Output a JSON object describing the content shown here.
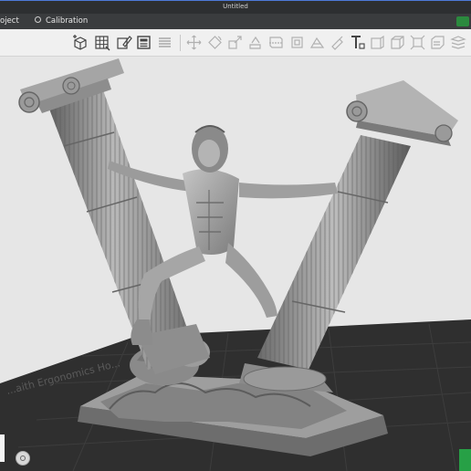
{
  "window": {
    "title": "Untitled"
  },
  "tabs": [
    {
      "label": "oject"
    },
    {
      "label": "Calibration"
    }
  ],
  "toolbar": {
    "buttons": [
      "add-cube-icon",
      "grid-layout-icon",
      "edit-model-icon",
      "slice-panel-icon",
      "list-icon",
      "move-icon",
      "rotate-icon",
      "scale-icon",
      "place-face-icon",
      "cut-icon",
      "support-icon",
      "seam-icon",
      "paint-icon",
      "text-icon",
      "measure-icon",
      "assemble-icon",
      "split-icon",
      "arrange-icon"
    ]
  },
  "viewport": {
    "plate_text": "...aith Ergonomics Ho..."
  },
  "colors": {
    "accent": "#27a046",
    "titlebar": "#2d2f31",
    "tabbar": "#3a3c3e",
    "plate": "#2f2f2f",
    "model": "#8f8f8f"
  }
}
